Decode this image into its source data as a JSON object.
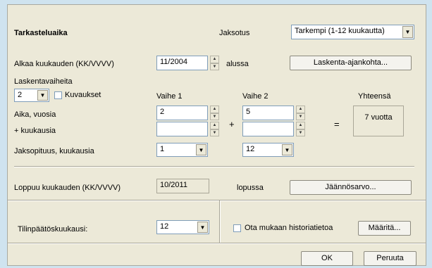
{
  "section": {
    "title": "Tarkasteluaika"
  },
  "jaksotus": {
    "label": "Jaksotus",
    "value": "Tarkempi (1-12 kuukautta)"
  },
  "start": {
    "label": "Alkaa kuukauden (KK/VVVV)",
    "value": "11/2004",
    "suffix": "alussa",
    "button": "Laskenta-ajankohta..."
  },
  "phases": {
    "label": "Laskentavaiheita",
    "count": "2",
    "kuvaukset": "Kuvaukset",
    "col1": "Vaihe 1",
    "col2": "Vaihe 2",
    "total_col": "Yhteensä",
    "years_label": "Aika, vuosia",
    "months_label": "+ kuukausia",
    "p1_years": "2",
    "p1_months": "",
    "p2_years": "5",
    "p2_months": "",
    "plus": "+",
    "equals": "=",
    "total": "7 vuotta",
    "period_label": "Jaksopituus, kuukausia",
    "p1_period": "1",
    "p2_period": "12"
  },
  "end": {
    "label": "Loppuu kuukauden (KK/VVVV)",
    "value": "10/2011",
    "suffix": "lopussa",
    "button": "Jäännösarvo..."
  },
  "closing": {
    "label": "Tilinpäätöskuukausi:",
    "value": "12"
  },
  "history": {
    "checkbox": "Ota mukaan historiatietoa",
    "button": "Määritä..."
  },
  "footer": {
    "ok": "OK",
    "cancel": "Peruuta"
  }
}
